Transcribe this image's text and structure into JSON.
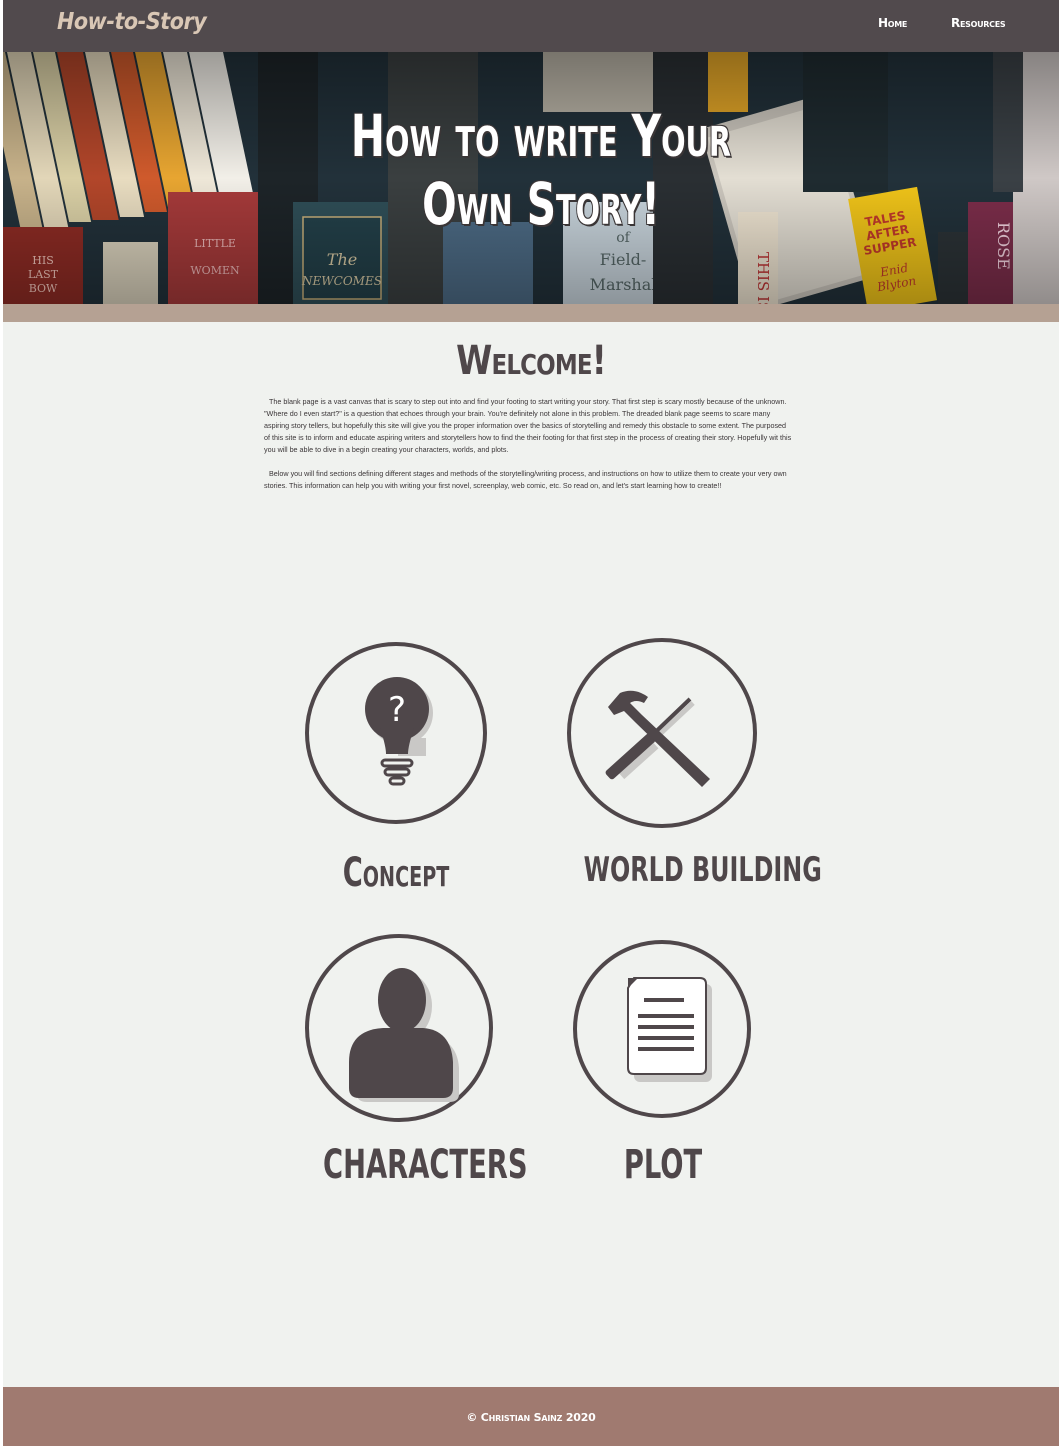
{
  "nav": {
    "brand": "How-to-Story",
    "links": [
      "Home",
      "Resources"
    ]
  },
  "hero": {
    "title_line1": "How to write Your",
    "title_line2": "Own Story!",
    "book_titles": [
      "THE NEWCOMES",
      "TALES AFTER SUPPER",
      "Enid Blyton",
      "HIS LAST BOW",
      "LITTLE WOMEN",
      "Field-Marshal",
      "THIS ISL",
      "ROSE"
    ]
  },
  "welcome": {
    "title": "Welcome!",
    "paragraph1": "The blank page is a vast canvas that is scary to step out into and find your footing to start writing your story. That first step is scary mostly because of the unknown. \"Where do I even start?\" is a question that echoes through your brain. You're definitely not alone in this problem. The dreaded blank page seems to scare many aspiring story tellers, but hopefully this site will give you the proper information over the basics of storytelling and remedy this obstacle to some extent.  The purposed of this site is to inform and educate aspiring writers and storytellers how to find the their footing for that first step in the process of creating their story.  Hopefully wit this you will be able to dive in a begin creating your characters, worlds, and plots.",
    "paragraph2": "Below you will find sections defining different stages and methods of the storytelling/writing process, and instructions on how to utilize them to create your very own stories. This information can help you with writing your first novel, screenplay, web comic, etc.  So read on, and let's start learning how to create!!"
  },
  "cards": {
    "concept": {
      "label": "Concept",
      "icon": "lightbulb-question-icon"
    },
    "world_building": {
      "label": "WORLD BUILDING",
      "icon": "hammer-screwdriver-icon"
    },
    "characters": {
      "label": "CHARACTERS",
      "icon": "person-icon"
    },
    "plot": {
      "label": "PLOT",
      "icon": "document-icon"
    }
  },
  "footer": {
    "text": "© Christian Sainz 2020"
  },
  "colors": {
    "nav_bg": "#514a4d",
    "brand": "#d9c7b5",
    "accent_strip": "#b5a193",
    "page_bg": "#f0f2ef",
    "icon_dark": "#4f474a",
    "footer_bg": "#a07a70"
  }
}
